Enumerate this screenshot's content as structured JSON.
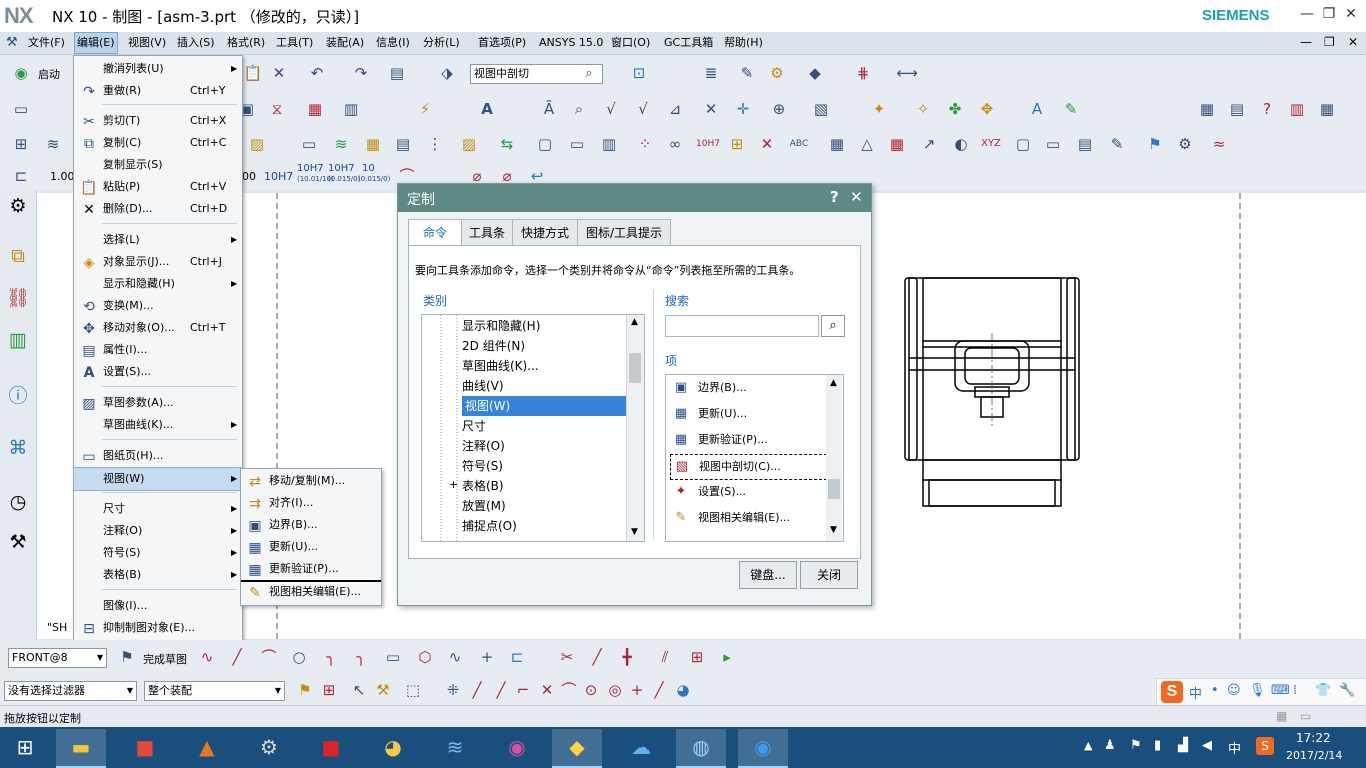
{
  "window": {
    "logo": "NX",
    "title": "NX 10 - 制图 - [asm-3.prt （修改的，只读）]",
    "brand": "SIEMENS",
    "min_glyph": "—",
    "restore_glyph": "❐",
    "close_glyph": "✕"
  },
  "menubar": {
    "items": [
      "文件(F)",
      "编辑(E)",
      "视图(V)",
      "插入(S)",
      "格式(R)",
      "工具(T)",
      "装配(A)",
      "信息(I)",
      "分析(L)",
      "首选项(P)",
      "ANSYS 15.0",
      "窗口(O)",
      "GC工具箱",
      "帮助(H)"
    ],
    "active": "编辑(E)"
  },
  "toolbar": {
    "start_label": "启动",
    "view_combo": "视图中剖切",
    "scale_value": "1.00",
    "tol_labels": [
      "10H7",
      "10H7",
      "10H7",
      "10"
    ],
    "tol_sub": [
      "(10.01/10)",
      "(0.015/0)",
      "(0.015/0)"
    ]
  },
  "edit_menu": {
    "items": [
      {
        "label": "撤消列表(U)",
        "shortcut": "",
        "icon": "",
        "submenu": true
      },
      {
        "label": "重做(R)",
        "shortcut": "Ctrl+Y",
        "icon": "redo-icon",
        "submenu": false
      },
      {
        "label": "剪切(T)",
        "shortcut": "Ctrl+X",
        "icon": "cut-icon",
        "submenu": false
      },
      {
        "label": "复制(C)",
        "shortcut": "Ctrl+C",
        "icon": "copy-icon",
        "submenu": false
      },
      {
        "label": "复制显示(S)",
        "shortcut": "",
        "icon": "",
        "submenu": false
      },
      {
        "label": "粘贴(P)",
        "shortcut": "Ctrl+V",
        "icon": "paste-icon",
        "submenu": false
      },
      {
        "label": "删除(D)...",
        "shortcut": "Ctrl+D",
        "icon": "delete-icon",
        "submenu": false
      },
      {
        "label": "选择(L)",
        "shortcut": "",
        "icon": "",
        "submenu": true
      },
      {
        "label": "对象显示(J)...",
        "shortcut": "Ctrl+J",
        "icon": "object-display-icon",
        "submenu": false
      },
      {
        "label": "显示和隐藏(H)",
        "shortcut": "",
        "icon": "",
        "submenu": true
      },
      {
        "label": "变换(M)...",
        "shortcut": "",
        "icon": "transform-icon",
        "submenu": false
      },
      {
        "label": "移动对象(O)...",
        "shortcut": "Ctrl+T",
        "icon": "move-object-icon",
        "submenu": false
      },
      {
        "label": "属性(I)...",
        "shortcut": "",
        "icon": "properties-icon",
        "submenu": false
      },
      {
        "label": "设置(S)...",
        "shortcut": "",
        "icon": "settings-icon",
        "submenu": false
      },
      {
        "label": "草图参数(A)...",
        "shortcut": "",
        "icon": "sketch-params-icon",
        "submenu": false
      },
      {
        "label": "草图曲线(K)...",
        "shortcut": "",
        "icon": "",
        "submenu": true
      },
      {
        "label": "图纸页(H)...",
        "shortcut": "",
        "icon": "drawing-sheet-icon",
        "submenu": false
      },
      {
        "label": "视图(W)",
        "shortcut": "",
        "icon": "",
        "submenu": true
      },
      {
        "label": "尺寸",
        "shortcut": "",
        "icon": "",
        "submenu": true
      },
      {
        "label": "注释(O)",
        "shortcut": "",
        "icon": "",
        "submenu": true
      },
      {
        "label": "符号(S)",
        "shortcut": "",
        "icon": "",
        "submenu": true
      },
      {
        "label": "表格(B)",
        "shortcut": "",
        "icon": "",
        "submenu": true
      },
      {
        "label": "图像(I)...",
        "shortcut": "",
        "icon": "",
        "submenu": false
      },
      {
        "label": "抑制制图对象(E)...",
        "shortcut": "",
        "icon": "suppress-icon",
        "submenu": false
      }
    ]
  },
  "view_submenu": {
    "items": [
      "移动/复制(M)...",
      "对齐(I)...",
      "边界(B)...",
      "更新(U)...",
      "更新验证(P)...",
      "视图相关编辑(E)..."
    ]
  },
  "dialog": {
    "title": "定制",
    "help_glyph": "?",
    "close_glyph": "✕",
    "tabs": [
      "命令",
      "工具条",
      "快捷方式",
      "图标/工具提示"
    ],
    "active_tab": "命令",
    "instruction": "要向工具条添加命令，选择一个类别并将命令从“命令”列表拖至所需的工具条。",
    "category_label": "类别",
    "categories": [
      "显示和隐藏(H)",
      "2D 组件(N)",
      "草图曲线(K)...",
      "曲线(V)",
      "视图(W)",
      "尺寸",
      "注释(O)",
      "符号(S)",
      "表格(B)",
      "放置(M)",
      "捕捉点(O)"
    ],
    "selected_category": "视图(W)",
    "search_label": "搜索",
    "search_value": "",
    "items_label": "项",
    "items": [
      "边界(B)...",
      "更新(U)...",
      "更新验证(P)...",
      "视图中剖切(C)...",
      "设置(S)...",
      "视图相关编辑(E)..."
    ],
    "focused_item": "视图中剖切(C)...",
    "keyboard_btn": "键盘...",
    "close_btn": "关闭"
  },
  "sheet": {
    "left_label": "\"SH"
  },
  "bottom": {
    "view_combo": "FRONT@8",
    "finish_sketch": "完成草图",
    "filter_combo": "没有选择过滤器",
    "assembly_combo": "整个装配"
  },
  "status": {
    "text": "拖放按钮以定制"
  },
  "taskbar": {
    "time": "17:22",
    "date": "2017/2/14",
    "ime": "中",
    "apps": [
      "start",
      "file-explorer",
      "catia",
      "matlab",
      "tool",
      "solidworks",
      "paint",
      "ansys",
      "camera",
      "nx",
      "cloud",
      "globe",
      "teamviewer"
    ]
  }
}
